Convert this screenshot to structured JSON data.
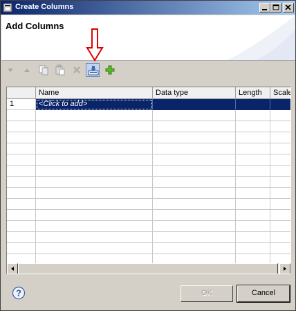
{
  "window": {
    "title": "Create Columns"
  },
  "header": {
    "title": "Add Columns"
  },
  "toolbar": {
    "tools": [
      {
        "name": "move-down",
        "icon": "arrow-down-icon",
        "enabled": false
      },
      {
        "name": "move-up",
        "icon": "arrow-up-icon",
        "enabled": false
      },
      {
        "name": "copy",
        "icon": "copy-icon",
        "enabled": false
      },
      {
        "name": "paste",
        "icon": "paste-icon",
        "enabled": false
      },
      {
        "name": "delete",
        "icon": "delete-icon",
        "enabled": false
      },
      {
        "name": "import",
        "icon": "import-icon",
        "enabled": true
      },
      {
        "name": "add",
        "icon": "plus-icon",
        "enabled": true
      }
    ]
  },
  "table": {
    "columns": [
      "",
      "Name",
      "Data type",
      "Length",
      "Scale"
    ],
    "rows": [
      {
        "num": "1",
        "name": "<Click to add>",
        "type": "",
        "length": "",
        "scale": ""
      }
    ]
  },
  "buttons": {
    "ok": "OK",
    "cancel": "Cancel"
  },
  "colors": {
    "title_bar": "#0a246a",
    "selection": "#0a246a",
    "annotation_arrow": "#e00000"
  }
}
